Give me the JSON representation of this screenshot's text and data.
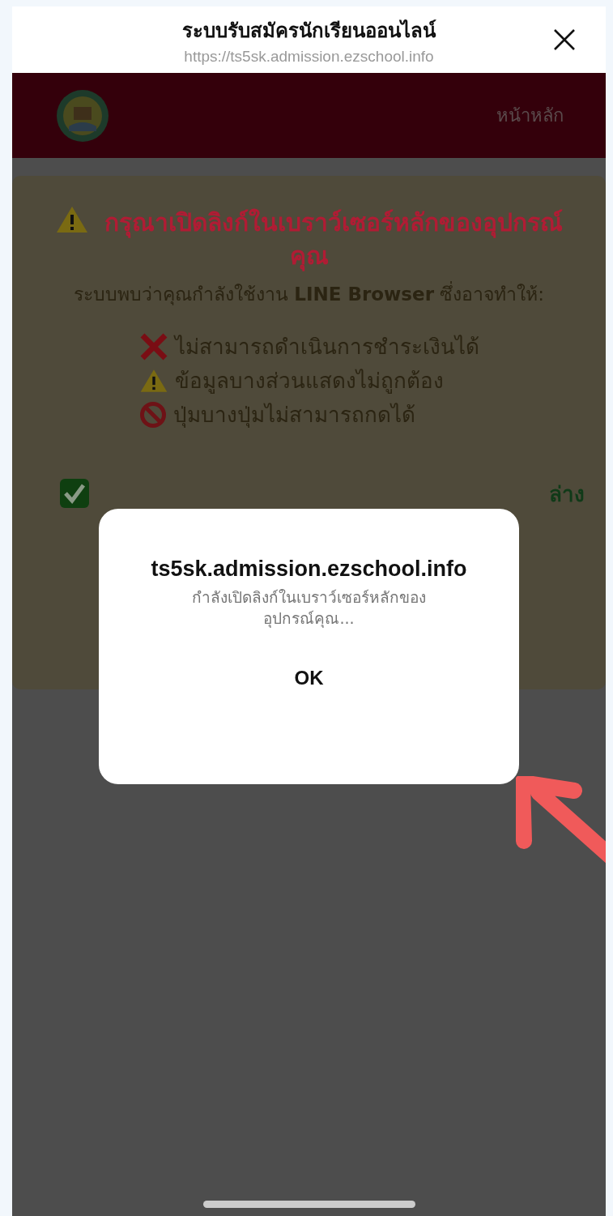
{
  "browser_bar": {
    "title": "ระบบรับสมัครนักเรียนออนไลน์",
    "url": "https://ts5sk.admission.ezschool.info"
  },
  "navbar": {
    "home_link": "หน้าหลัก"
  },
  "warning_card": {
    "heading": "กรุณาเปิดลิงก์ในเบราว์เซอร์หลักของอุปกรณ์คุณ",
    "message": "ระบบพบว่าคุณกำลังใช้งาน **LINE Browser** ซึ่งอาจทำให้:",
    "issues": [
      {
        "kind": "cross",
        "text": "ไม่สามารถดำเนินการชำระเงินได้"
      },
      {
        "kind": "warning",
        "text": "ข้อมูลบางส่วนแสดงไม่ถูกต้อง"
      },
      {
        "kind": "prohibited",
        "text": "ปุ่มบางปุ่มไม่สามารถกดได้"
      }
    ],
    "hint_tail": "ล่าง"
  },
  "dialog": {
    "title": "ts5sk.admission.ezschool.info",
    "message": "กำลังเปิดลิงก์ในเบราว์เซอร์หลักของอุปกรณ์คุณ...",
    "button": "OK"
  }
}
